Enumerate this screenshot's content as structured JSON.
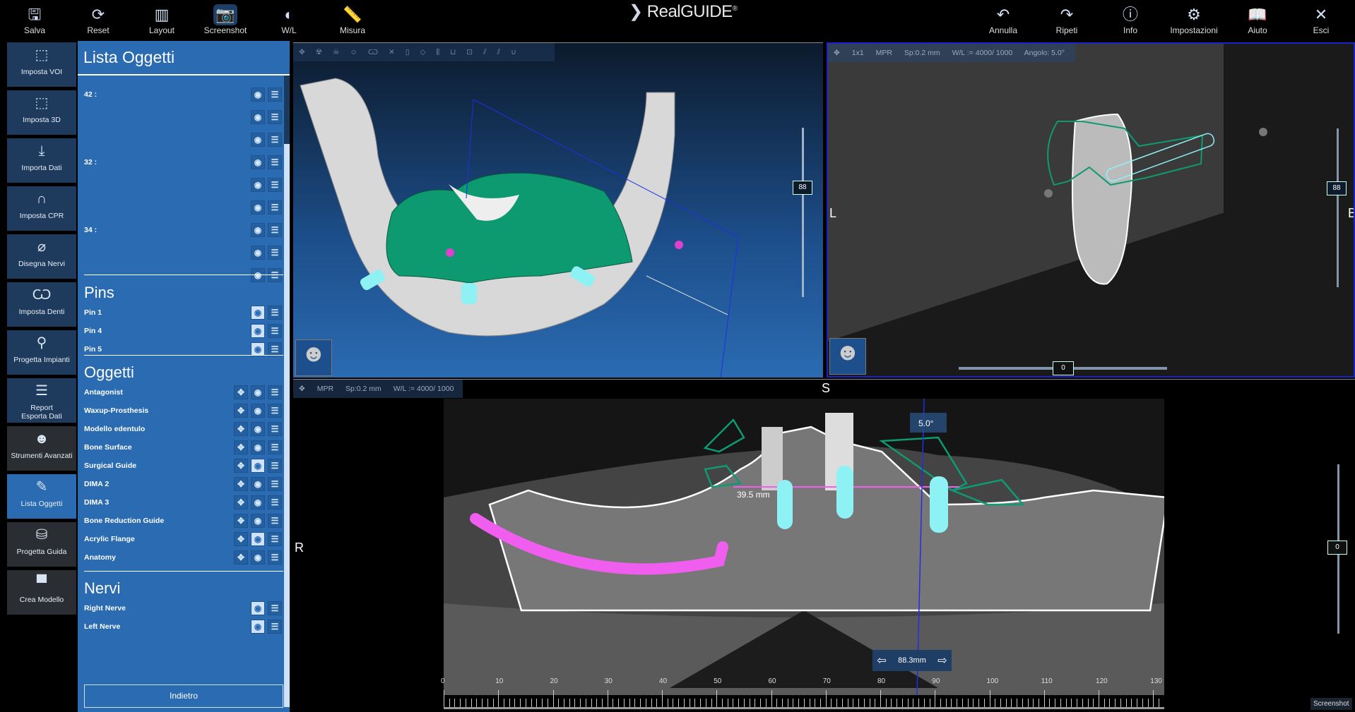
{
  "app": {
    "logo": "RealGUIDE",
    "logo_mark": "®"
  },
  "toolbar_left": [
    {
      "label": "Salva",
      "icon": "save-icon",
      "glyph": "🖫"
    },
    {
      "label": "Reset",
      "icon": "reset-icon",
      "glyph": "⟳"
    },
    {
      "label": "Layout",
      "icon": "layout-icon",
      "glyph": "▥"
    },
    {
      "label": "Screenshot",
      "icon": "camera-icon",
      "glyph": "📷",
      "active": true
    },
    {
      "label": "W/L",
      "icon": "contrast-icon",
      "glyph": "◐"
    },
    {
      "label": "Misura",
      "icon": "ruler-icon",
      "glyph": "📏"
    }
  ],
  "toolbar_right": [
    {
      "label": "Annulla",
      "icon": "undo-icon",
      "glyph": "↶"
    },
    {
      "label": "Ripeti",
      "icon": "redo-icon",
      "glyph": "↷"
    },
    {
      "label": "Info",
      "icon": "info-icon",
      "glyph": "ⓘ"
    },
    {
      "label": "Impostazioni",
      "icon": "gear-icon",
      "glyph": "⚙"
    },
    {
      "label": "Aiuto",
      "icon": "book-icon",
      "glyph": "📖"
    },
    {
      "label": "Esci",
      "icon": "close-icon",
      "glyph": "✕"
    }
  ],
  "sidebar": [
    {
      "label": "Imposta VOI",
      "icon": "cube-icon",
      "glyph": "⬚"
    },
    {
      "label": "Imposta 3D",
      "icon": "cube-icon",
      "glyph": "⬚"
    },
    {
      "label": "Importa Dati",
      "icon": "download-icon",
      "glyph": "⤓"
    },
    {
      "label": "Imposta CPR",
      "icon": "arch-icon",
      "glyph": "∩"
    },
    {
      "label": "Disegna Nervi",
      "icon": "nerve-icon",
      "glyph": "⌀"
    },
    {
      "label": "Imposta Denti",
      "icon": "tooth-icon",
      "glyph": "Ѡ"
    },
    {
      "label": "Progetta Impianti",
      "icon": "implant-icon",
      "glyph": "⚲"
    },
    {
      "label": "Report\nEsporta Dati",
      "icon": "report-icon",
      "glyph": "☰"
    },
    {
      "label": "Strumenti Avanzati",
      "icon": "head-icon",
      "glyph": "☻",
      "dark": true
    },
    {
      "label": "Lista Oggetti",
      "icon": "edit-icon",
      "glyph": "✎",
      "active": true
    },
    {
      "label": "Progetta Guida",
      "icon": "guide-icon",
      "glyph": "⛁",
      "dark": true
    },
    {
      "label": "Crea Modello",
      "icon": "model-icon",
      "glyph": "▀",
      "dark": true
    }
  ],
  "list": {
    "title": "Lista Oggetti",
    "teeth_rows": [
      {
        "label": "42 :"
      },
      {
        "label": ""
      },
      {
        "label": ""
      },
      {
        "label": "32 :"
      },
      {
        "label": ""
      },
      {
        "label": ""
      },
      {
        "label": "34 :"
      },
      {
        "label": ""
      },
      {
        "label": ""
      }
    ],
    "pins_title": "Pins",
    "pins": [
      {
        "label": "Pin 1",
        "visible": true
      },
      {
        "label": "Pin 4",
        "visible": true
      },
      {
        "label": "Pin 5",
        "visible": true
      }
    ],
    "oggetti_title": "Oggetti",
    "oggetti": [
      {
        "label": "Antagonist",
        "visible": false
      },
      {
        "label": "Waxup-Prosthesis",
        "visible": false
      },
      {
        "label": "Modello edentulo",
        "visible": false
      },
      {
        "label": "Bone Surface",
        "visible": false
      },
      {
        "label": "Surgical Guide",
        "visible": true
      },
      {
        "label": "DIMA 2",
        "visible": false
      },
      {
        "label": "DIMA 3",
        "visible": false
      },
      {
        "label": "Bone Reduction Guide",
        "visible": false
      },
      {
        "label": "Acrylic Flange",
        "visible": true
      },
      {
        "label": "Anatomy",
        "visible": false
      }
    ],
    "nervi_title": "Nervi",
    "nervi": [
      {
        "label": "Right Nerve",
        "visible": true
      },
      {
        "label": "Left Nerve",
        "visible": true
      }
    ],
    "back_label": "Indietro"
  },
  "view3d": {
    "slider_value": "88"
  },
  "view_cross": {
    "layout": "1x1",
    "mode": "MPR",
    "spacing": "Sp:0.2 mm",
    "wl": "W/L := 4000/ 1000",
    "angle": "Angolo: 5.0°",
    "left_label": "L",
    "right_label": "B",
    "slider_value": "88",
    "h_slider_value": "0"
  },
  "view_pano": {
    "mode": "MPR",
    "spacing": "Sp:0.2 mm",
    "wl": "W/L := 4000/ 1000",
    "top_label": "S",
    "left_label": "R",
    "angle": "5.0°",
    "measure": "39.5 mm",
    "position": "88.3mm",
    "slider_value": "0",
    "ruler_ticks": [
      "0",
      "10",
      "20",
      "30",
      "40",
      "50",
      "60",
      "70",
      "80",
      "90",
      "100",
      "110",
      "120",
      "130"
    ]
  },
  "status": {
    "screenshot_label": "Screenshot"
  },
  "colors": {
    "panel": "#2a6bb1",
    "sidebar": "#1e3a5c",
    "guide": "#0f9a72",
    "implant": "#8ef2f5",
    "nerve": "#f05ef0"
  }
}
